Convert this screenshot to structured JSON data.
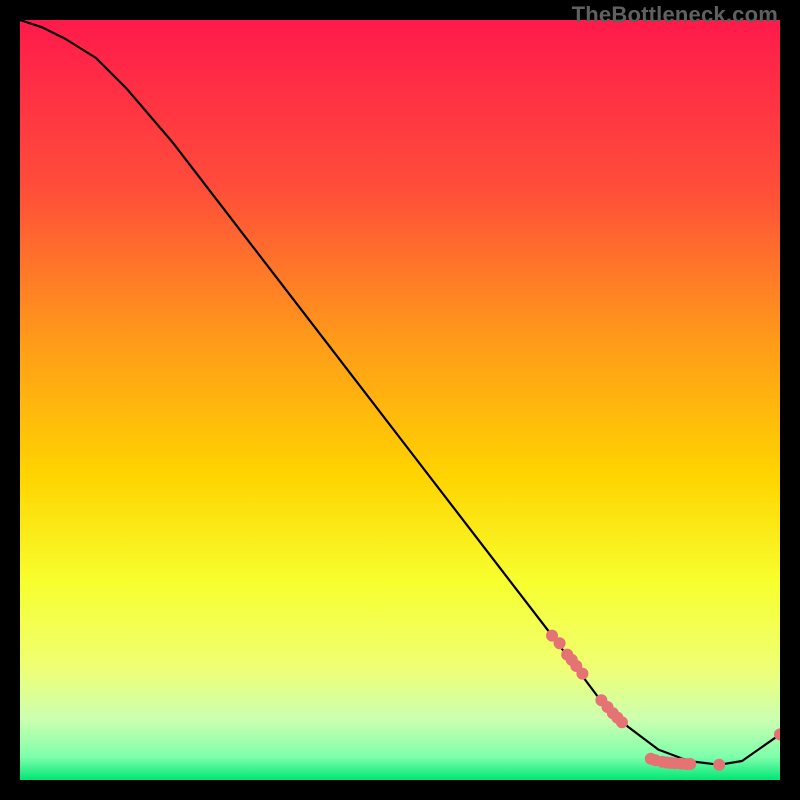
{
  "watermark": "TheBottleneck.com",
  "chart_data": {
    "type": "line",
    "title": "",
    "xlabel": "",
    "ylabel": "",
    "xlim": [
      0,
      100
    ],
    "ylim": [
      0,
      100
    ],
    "grid": false,
    "legend": false,
    "gradient_colors": {
      "top": "#ff1a4b",
      "upper_mid": "#ff7a00",
      "mid": "#ffd400",
      "lower_mid": "#f7ff2e",
      "pale": "#e8ffb0",
      "bottom": "#00e676"
    },
    "series": [
      {
        "name": "curve",
        "stroke": "#000000",
        "x": [
          0,
          3,
          6,
          10,
          14,
          20,
          30,
          40,
          50,
          60,
          70,
          76,
          80,
          84,
          88,
          92,
          95,
          100
        ],
        "y": [
          100,
          99,
          97.5,
          95,
          91,
          84,
          71,
          58,
          45,
          32,
          19,
          11,
          7,
          4,
          2.5,
          2,
          2.5,
          6
        ]
      }
    ],
    "markers": [
      {
        "name": "dots",
        "color": "#e57373",
        "radius": 6,
        "points": [
          {
            "x": 70,
            "y": 19
          },
          {
            "x": 71,
            "y": 18
          },
          {
            "x": 72,
            "y": 16.5
          },
          {
            "x": 72.6,
            "y": 15.8
          },
          {
            "x": 73.2,
            "y": 15
          },
          {
            "x": 74,
            "y": 14
          },
          {
            "x": 76.5,
            "y": 10.5
          },
          {
            "x": 77.3,
            "y": 9.6
          },
          {
            "x": 78,
            "y": 8.8
          },
          {
            "x": 78.6,
            "y": 8.2
          },
          {
            "x": 79.2,
            "y": 7.6
          },
          {
            "x": 83,
            "y": 2.8
          },
          {
            "x": 83.6,
            "y": 2.6
          },
          {
            "x": 84.5,
            "y": 2.4
          },
          {
            "x": 85.1,
            "y": 2.3
          },
          {
            "x": 85.6,
            "y": 2.25
          },
          {
            "x": 86.2,
            "y": 2.2
          },
          {
            "x": 87,
            "y": 2.15
          },
          {
            "x": 87.7,
            "y": 2.1
          },
          {
            "x": 88.2,
            "y": 2.1
          },
          {
            "x": 92,
            "y": 2.0
          },
          {
            "x": 100,
            "y": 6
          }
        ]
      }
    ]
  }
}
